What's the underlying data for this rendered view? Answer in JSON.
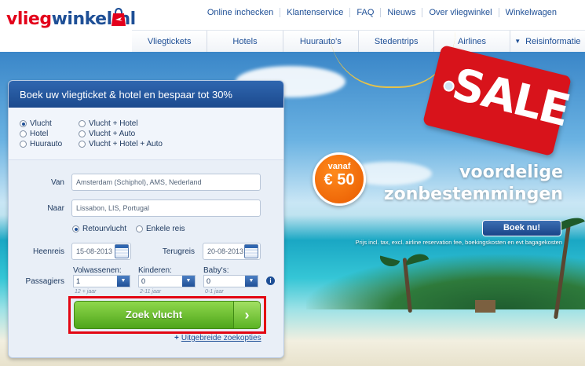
{
  "brand": {
    "part1": "vlieg",
    "part2": "winkel.nl"
  },
  "topnav": [
    "Online inchecken",
    "Klantenservice",
    "FAQ",
    "Nieuws",
    "Over vliegwinkel",
    "Winkelwagen"
  ],
  "mainnav": [
    "Vliegtickets",
    "Hotels",
    "Huurauto's",
    "Stedentrips",
    "Airlines",
    "Reisinformatie"
  ],
  "promo": {
    "sale": "SALE",
    "vanaf": "vanaf",
    "price": "€ 50",
    "line1": "voordelige",
    "line2": "zonbestemmingen",
    "cta": "Boek nu!",
    "disclaimer": "Prijs incl. tax, excl. airline reservation fee, boekingskosten en evt bagagekosten"
  },
  "search": {
    "title": "Boek uw vliegticket & hotel en bespaar tot 30%",
    "types_left": [
      "Vlucht",
      "Hotel",
      "Huurauto"
    ],
    "types_right": [
      "Vlucht + Hotel",
      "Vlucht + Auto",
      "Vlucht + Hotel + Auto"
    ],
    "selected_type": "Vlucht",
    "van_label": "Van",
    "van_value": "Amsterdam (Schiphol), AMS, Nederland",
    "naar_label": "Naar",
    "naar_value": "Lissabon, LIS, Portugal",
    "trip_return": "Retourvlucht",
    "trip_oneway": "Enkele reis",
    "heenreis_label": "Heenreis",
    "heenreis_value": "15-08-2013",
    "terugreis_label": "Terugreis",
    "terugreis_value": "20-08-2013",
    "passagiers_label": "Passagiers",
    "adults_label": "Volwassenen:",
    "adults_value": "1",
    "adults_hint": "12 + jaar",
    "kids_label": "Kinderen:",
    "kids_value": "0",
    "kids_hint": "2-11 jaar",
    "babies_label": "Baby's:",
    "babies_value": "0",
    "babies_hint": "0-1 jaar",
    "submit": "Zoek vlucht",
    "advanced": "Uitgebreide zoekopties"
  },
  "colors": {
    "brand_red": "#e3001b",
    "brand_blue": "#1e4f96",
    "cta_green": "#5bb324",
    "sale_red": "#d8131b",
    "price_orange": "#e85a00"
  }
}
